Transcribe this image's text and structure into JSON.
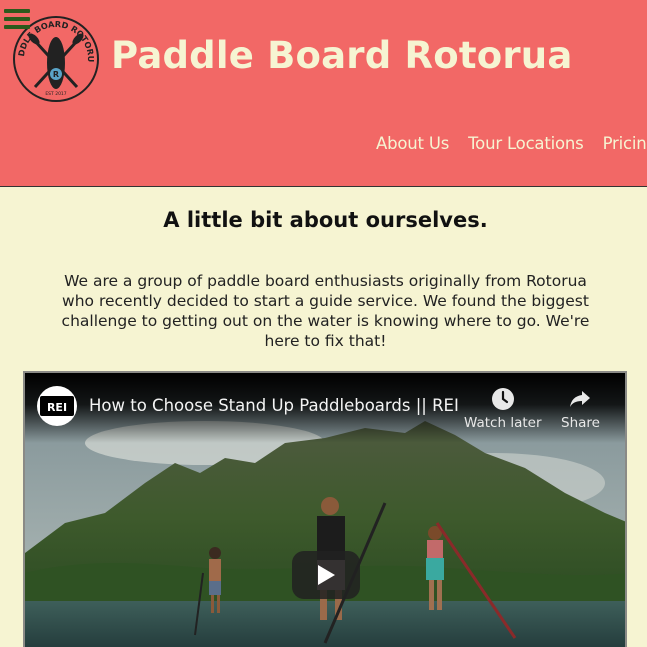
{
  "header": {
    "site_title": "Paddle Board Rotorua",
    "logo": {
      "text": "PADDLE BOARD ROTORUA",
      "badge_letter": "R",
      "est": "EST 2017"
    },
    "nav": [
      {
        "label": "About Us"
      },
      {
        "label": "Tour Locations"
      },
      {
        "label": "Pricing"
      }
    ]
  },
  "main": {
    "heading": "A little bit about ourselves.",
    "intro": "We are a group of paddle board enthusiasts originally from Rotorua who recently decided to start a guide service. We found the biggest challenge to getting out on the water is knowing where to go. We're here to fix that!"
  },
  "video": {
    "title": "How to Choose Stand Up Paddleboards || REI",
    "channel_logo_text": "REI",
    "watch_later_label": "Watch later",
    "share_label": "Share",
    "play_icon": "play-icon"
  },
  "colors": {
    "header_bg": "#f26866",
    "page_bg": "#f6f4d2",
    "title_text": "#f6f4d2",
    "menu_icon": "#2c5a1c"
  }
}
